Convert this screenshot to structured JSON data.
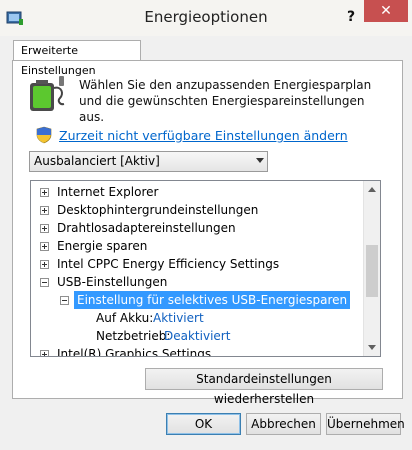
{
  "window": {
    "title": "Energieoptionen",
    "help_label": "?",
    "close_label": "✕"
  },
  "tab": {
    "label": "Erweiterte Einstellungen"
  },
  "description": "Wählen Sie den anzupassenden Energiesparplan und die gewünschten Energiespareinstellungen aus.",
  "link": {
    "label": "Zurzeit nicht verfügbare Einstellungen ändern"
  },
  "plan_select": {
    "value": "Ausbalanciert [Aktiv]"
  },
  "tree": {
    "items": [
      {
        "label": "Internet Explorer",
        "expanded": false
      },
      {
        "label": "Desktophintergrundeinstellungen",
        "expanded": false
      },
      {
        "label": "Drahtlosadaptereinstellungen",
        "expanded": false
      },
      {
        "label": "Energie sparen",
        "expanded": false
      },
      {
        "label": "Intel CPPC Energy Efficiency Settings",
        "expanded": false
      },
      {
        "label": "USB-Einstellungen",
        "expanded": true
      },
      {
        "label": "Einstellung für selektives USB-Energiesparen",
        "expanded": true,
        "selected": true
      },
      {
        "label": "Auf Akku:",
        "value": "Aktiviert"
      },
      {
        "label": "Netzbetrieb:",
        "value": "Deaktiviert"
      },
      {
        "label": "Intel(R) Graphics Settings",
        "expanded": false
      }
    ]
  },
  "buttons": {
    "restore": "Standardeinstellungen wiederherstellen",
    "ok": "OK",
    "cancel": "Abbrechen",
    "apply": "Übernehmen"
  },
  "colors": {
    "selection": "#3399ff",
    "link": "#0066cc",
    "close": "#c75050"
  }
}
